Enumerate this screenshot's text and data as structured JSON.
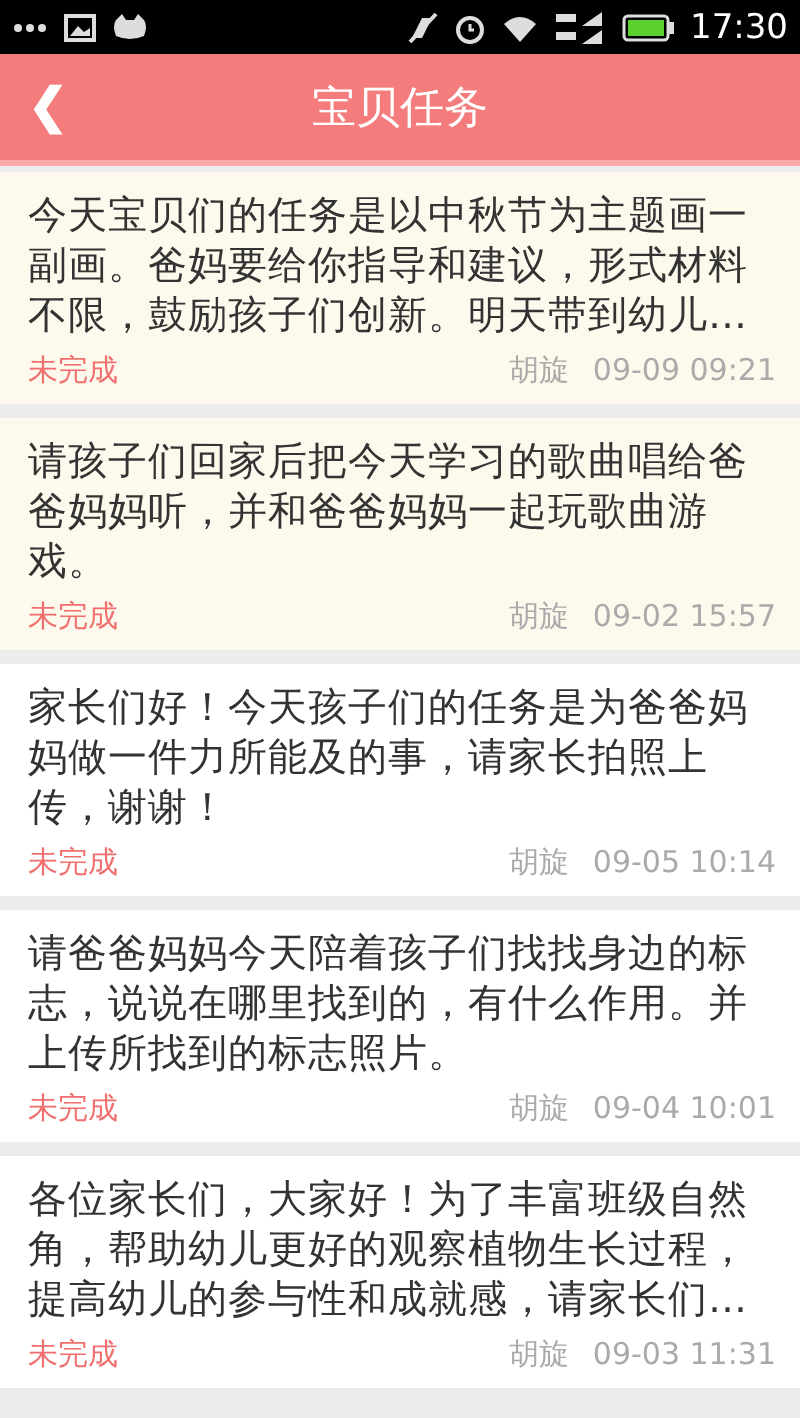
{
  "status_bar": {
    "time": "17:30"
  },
  "header": {
    "back": "❮",
    "title": "宝贝任务"
  },
  "tasks": [
    {
      "text": "今天宝贝们的任务是以中秋节为主题画一副画。爸妈要给你指导和建议，形式材料不限，鼓励孩子们创新。明天带到幼儿…",
      "status": "未完成",
      "author": "胡旋",
      "time": "09-09 09:21",
      "unread": true
    },
    {
      "text": "请孩子们回家后把今天学习的歌曲唱给爸爸妈妈听，并和爸爸妈妈一起玩歌曲游戏。",
      "status": "未完成",
      "author": "胡旋",
      "time": "09-02 15:57",
      "unread": true
    },
    {
      "text": "家长们好！今天孩子们的任务是为爸爸妈妈做一件力所能及的事，请家长拍照上传，谢谢！",
      "status": "未完成",
      "author": "胡旋",
      "time": "09-05 10:14",
      "unread": false
    },
    {
      "text": "请爸爸妈妈今天陪着孩子们找找身边的标志，说说在哪里找到的，有什么作用。并上传所找到的标志照片。",
      "status": "未完成",
      "author": "胡旋",
      "time": "09-04 10:01",
      "unread": false
    },
    {
      "text": "各位家长们，大家好！为了丰富班级自然角，帮助幼儿更好的观察植物生长过程，提高幼儿的参与性和成就感，请家长们…",
      "status": "未完成",
      "author": "胡旋",
      "time": "09-03 11:31",
      "unread": false
    }
  ]
}
